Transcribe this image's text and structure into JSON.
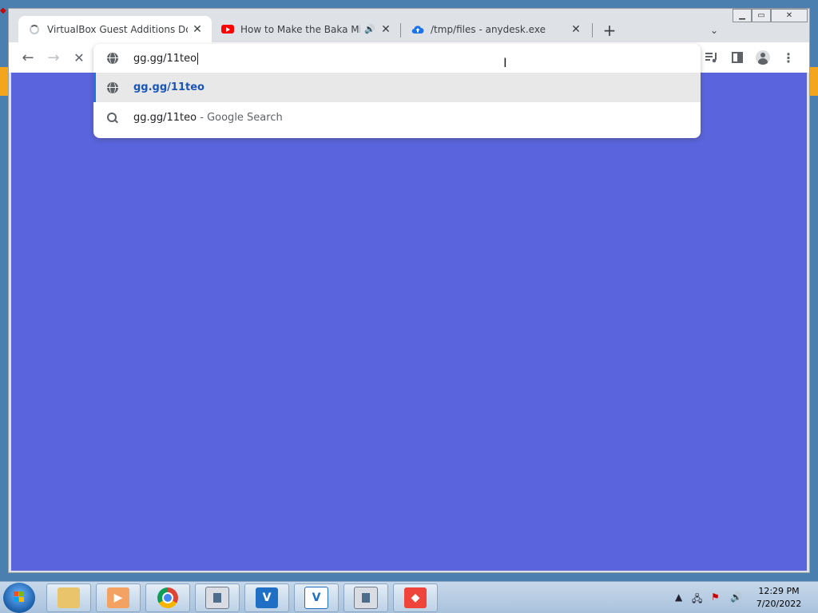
{
  "browser": {
    "tabs": [
      {
        "title": "VirtualBox Guest Additions Down",
        "favicon": "loading-spinner",
        "active": true
      },
      {
        "title": "How to Make the Baka Mita",
        "favicon": "youtube-icon",
        "audio": true,
        "active": false
      },
      {
        "title": "/tmp/files - anydesk.exe",
        "favicon": "cloud-upload-icon",
        "active": false
      }
    ],
    "new_tab_label": "+",
    "tab_search_icon": "chevron-down-icon"
  },
  "omnibox": {
    "value": "gg.gg/11teo",
    "suggestions": [
      {
        "icon": "globe-icon",
        "text": "gg.gg/11teo",
        "secondary": "",
        "selected": true
      },
      {
        "icon": "search-icon",
        "text": "gg.gg/11teo",
        "secondary": " - Google Search",
        "selected": false
      }
    ]
  },
  "page": {
    "background": "#5a64dc"
  },
  "taskbar": {
    "apps": [
      "file-explorer",
      "media-player",
      "chrome",
      "text-editor",
      "vs-code",
      "vs-code-2",
      "document-app",
      "anydesk"
    ],
    "clock_time": "12:29 PM",
    "clock_date": "7/20/2022"
  }
}
